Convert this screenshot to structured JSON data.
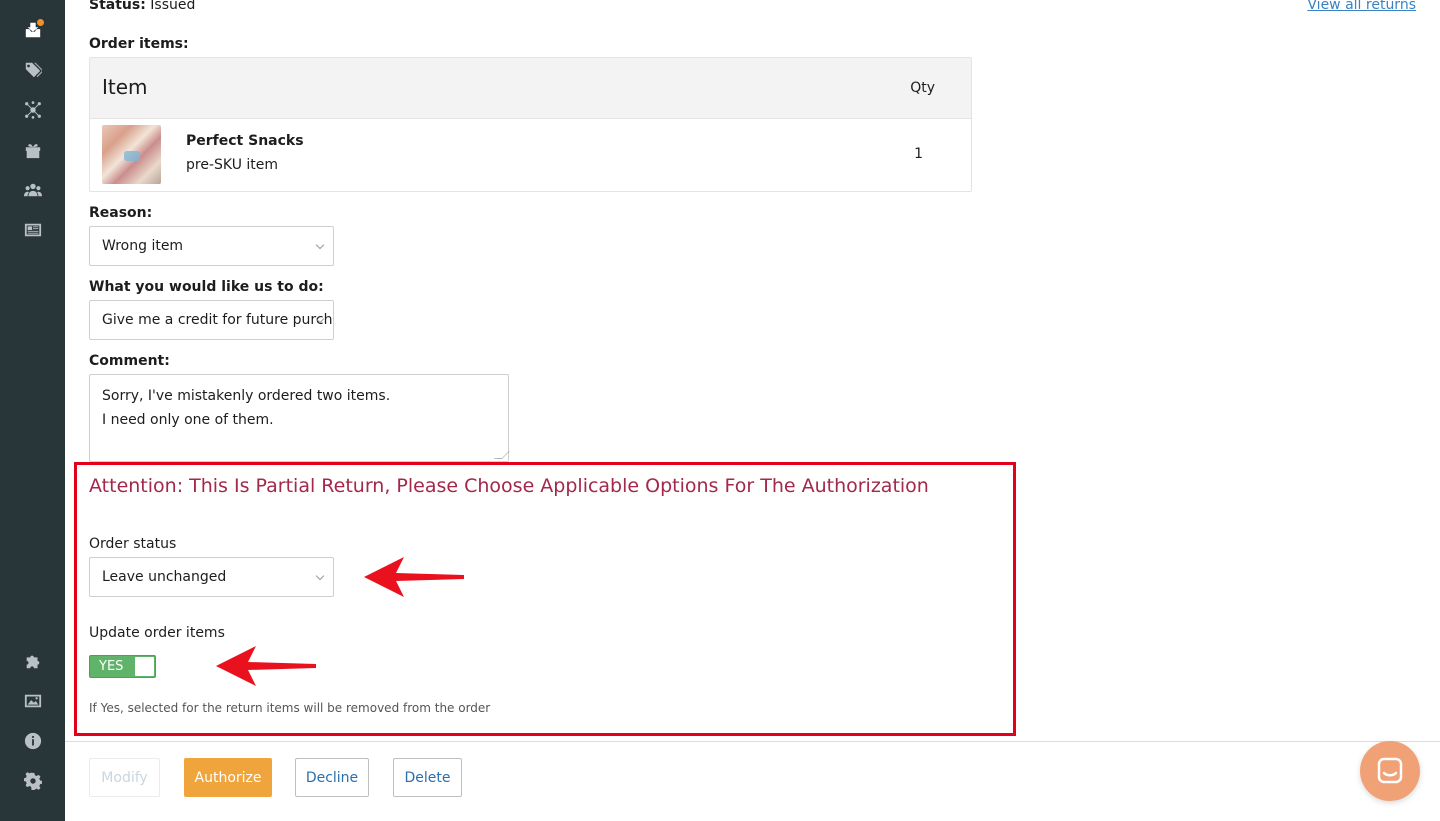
{
  "sidebar": {
    "icons": [
      "returns-icon",
      "tag-icon",
      "network-icon",
      "gift-icon",
      "users-icon",
      "news-icon",
      "puzzle-icon",
      "image-icon",
      "info-icon",
      "gear-icon"
    ],
    "has_notification": true
  },
  "header": {
    "status_label": "Status:",
    "status_value": "Issued",
    "view_all": "View all returns"
  },
  "order_items": {
    "label": "Order items:",
    "columns": {
      "item": "Item",
      "qty": "Qty"
    },
    "rows": [
      {
        "name": "Perfect Snacks",
        "sku": "pre-SKU item",
        "qty": "1"
      }
    ]
  },
  "reason": {
    "label": "Reason:",
    "value": "Wrong item"
  },
  "action": {
    "label": "What you would like us to do:",
    "value": "Give me a credit for future purchase"
  },
  "comment": {
    "label": "Comment:",
    "line1": "Sorry, I've mistakenly ordered two items.",
    "line2": "I need only one of them."
  },
  "attention": {
    "title": "Attention: This Is Partial Return, Please Choose Applicable Options For The Authorization",
    "order_status_label": "Order status",
    "order_status_value": "Leave unchanged",
    "update_items_label": "Update order items",
    "toggle_value": "YES",
    "hint": "If Yes, selected for the return items will be removed from the order"
  },
  "buttons": {
    "modify": "Modify",
    "authorize": "Authorize",
    "decline": "Decline",
    "delete": "Delete"
  },
  "colors": {
    "sidebar_bg": "#283539",
    "accent_orange": "#f0a53c",
    "highlight_red": "#e3001b",
    "attention_text": "#a3284a",
    "toggle_green": "#5fb46a",
    "link_blue": "#3a82c4"
  }
}
